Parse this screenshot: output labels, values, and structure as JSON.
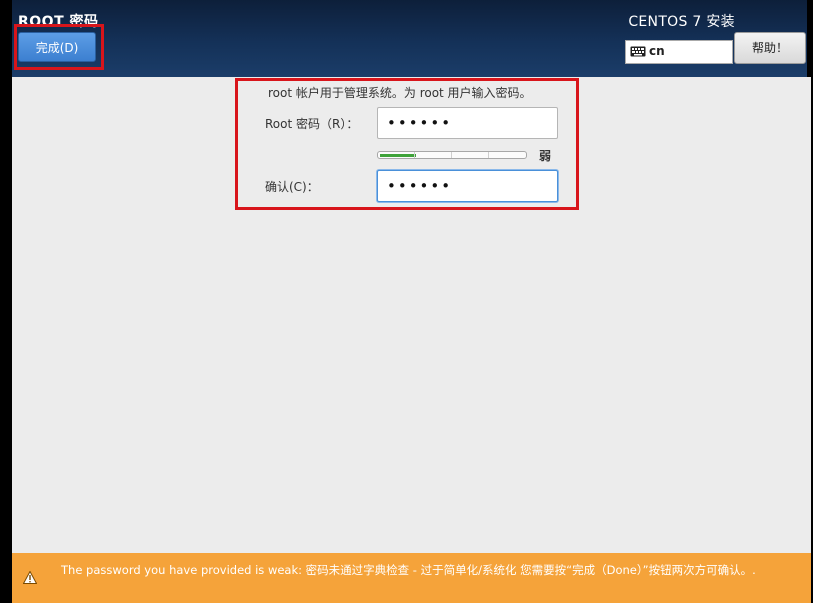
{
  "header": {
    "title": "ROOT 密码",
    "done_label": "完成(D)",
    "product_title": "CENTOS 7 安装",
    "keyboard_layout": "cn",
    "help_label": "帮助！"
  },
  "form": {
    "description": "root 帐户用于管理系统。为 root 用户输入密码。",
    "root_password_label": "Root 密码（R）：",
    "root_password_value": "••••••",
    "confirm_label": "确认(C)：",
    "confirm_value": "••••••",
    "strength_label": "弱",
    "strength_level": 0.25
  },
  "warning": {
    "message": "The password you have provided is weak: 密码未通过字典检查 - 过于简单化/系统化 您需要按“完成（Done）”按钮两次方可确认。."
  },
  "colors": {
    "header_bg": "#143158",
    "done_button": "#3c7fd0",
    "highlight": "#d8151b",
    "warning_bar": "#f5a33a",
    "meter_fill": "#3fa33a"
  },
  "icons": {
    "keyboard": "keyboard-icon",
    "warning": "warning-icon"
  }
}
